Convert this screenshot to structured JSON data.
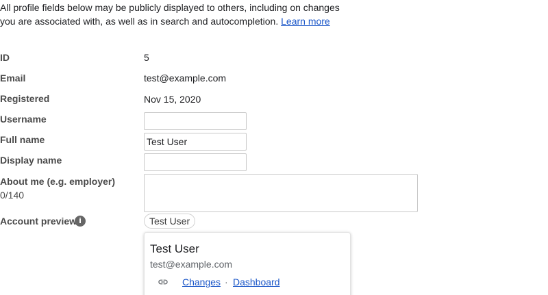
{
  "intro": {
    "text": "All profile fields below may be publicly displayed to others, including on changes you are associated with, as well as in search and autocompletion.",
    "learn_more": "Learn more"
  },
  "fields": {
    "id": {
      "label": "ID",
      "value": "5"
    },
    "email": {
      "label": "Email",
      "value": "test@example.com"
    },
    "registered": {
      "label": "Registered",
      "value": "Nov 15, 2020"
    },
    "username": {
      "label": "Username",
      "value": ""
    },
    "full_name": {
      "label": "Full name",
      "value": "Test User"
    },
    "display_name": {
      "label": "Display name",
      "value": ""
    },
    "about_me": {
      "label": "About me (e.g. employer)",
      "counter": "0/140",
      "value": ""
    },
    "account_preview": {
      "label": "Account preview",
      "chip": "Test User"
    }
  },
  "preview_card": {
    "name": "Test User",
    "email": "test@example.com",
    "link_icon": "link-icon",
    "changes_link": "Changes",
    "separator": "·",
    "dashboard_link": "Dashboard"
  },
  "colors": {
    "link": "#1a56c8",
    "label": "#4a4a4a",
    "border": "#c8c8c8"
  }
}
